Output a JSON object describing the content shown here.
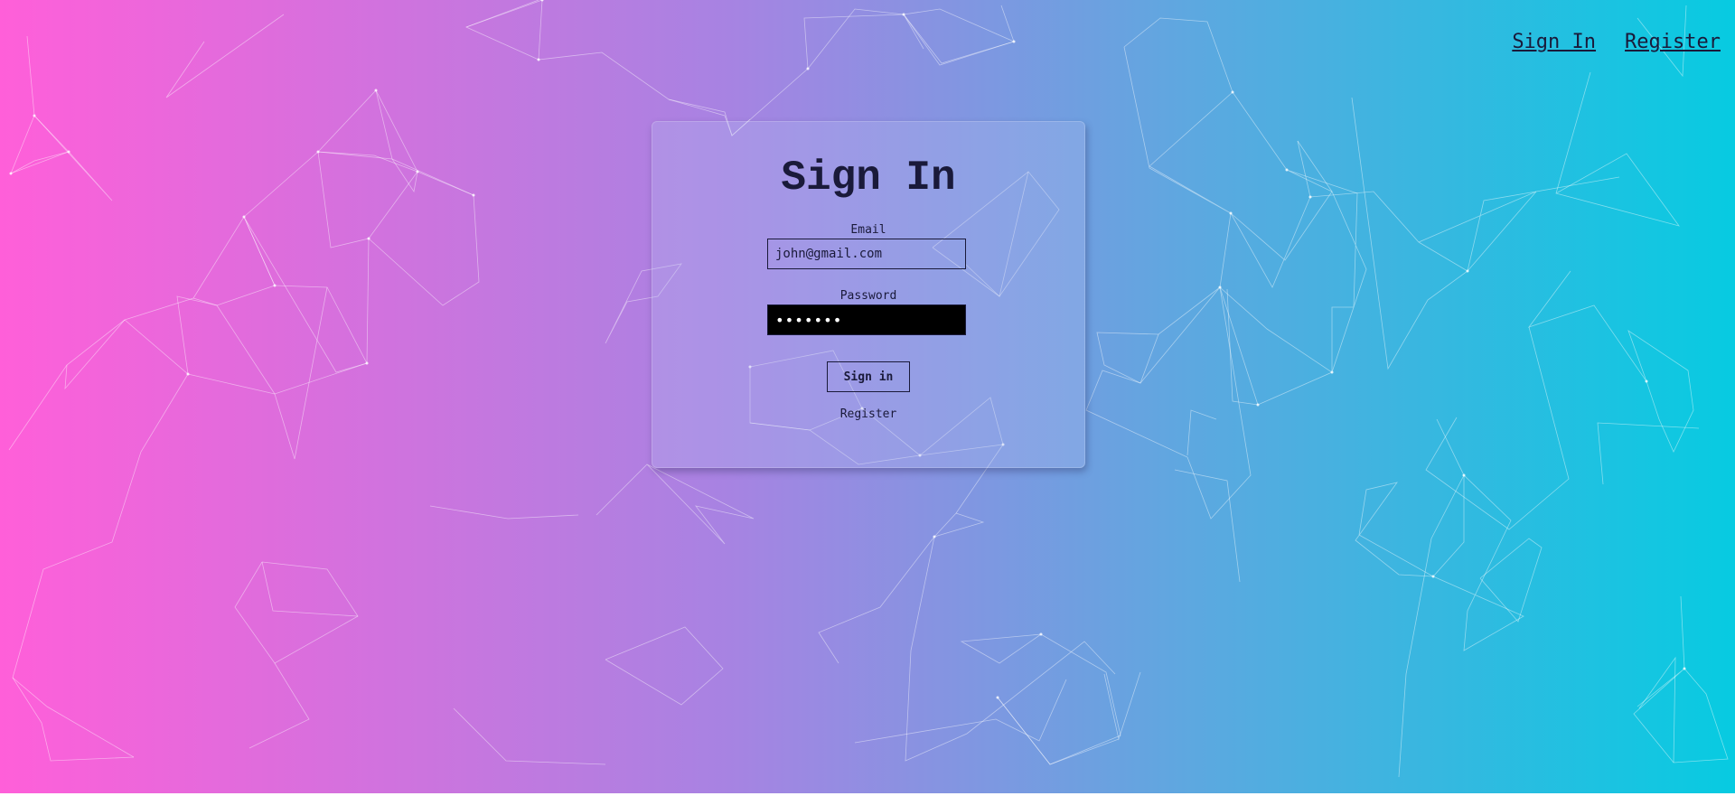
{
  "nav": {
    "sign_in": "Sign In",
    "register": "Register"
  },
  "form": {
    "title": "Sign In",
    "email_label": "Email",
    "email_value": "john@gmail.com",
    "password_label": "Password",
    "password_value": "•••••••",
    "submit_label": "Sign in",
    "register_link": "Register"
  },
  "colors": {
    "gradient_start": "#ff5fd9",
    "gradient_end": "#07cbe1",
    "text": "#1a1a3a"
  }
}
